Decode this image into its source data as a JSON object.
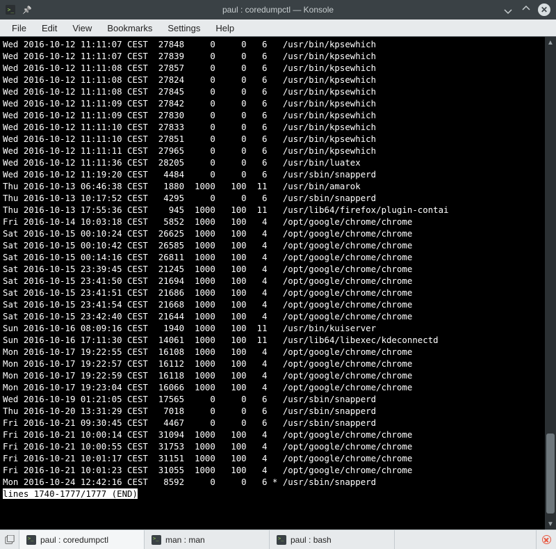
{
  "window": {
    "title": "paul : coredumpctl — Konsole"
  },
  "menubar": [
    "File",
    "Edit",
    "View",
    "Bookmarks",
    "Settings",
    "Help"
  ],
  "terminal": {
    "status_line": "lines 1740-1777/1777 (END)",
    "rows": [
      {
        "t": "Wed 2016-10-12 11:11:07 CEST",
        "pid": "27848",
        "uid": "0",
        "gid": "0",
        "sig": "6",
        "mk": " ",
        "exe": "/usr/bin/kpsewhich"
      },
      {
        "t": "Wed 2016-10-12 11:11:07 CEST",
        "pid": "27839",
        "uid": "0",
        "gid": "0",
        "sig": "6",
        "mk": " ",
        "exe": "/usr/bin/kpsewhich"
      },
      {
        "t": "Wed 2016-10-12 11:11:08 CEST",
        "pid": "27857",
        "uid": "0",
        "gid": "0",
        "sig": "6",
        "mk": " ",
        "exe": "/usr/bin/kpsewhich"
      },
      {
        "t": "Wed 2016-10-12 11:11:08 CEST",
        "pid": "27824",
        "uid": "0",
        "gid": "0",
        "sig": "6",
        "mk": " ",
        "exe": "/usr/bin/kpsewhich"
      },
      {
        "t": "Wed 2016-10-12 11:11:08 CEST",
        "pid": "27845",
        "uid": "0",
        "gid": "0",
        "sig": "6",
        "mk": " ",
        "exe": "/usr/bin/kpsewhich"
      },
      {
        "t": "Wed 2016-10-12 11:11:09 CEST",
        "pid": "27842",
        "uid": "0",
        "gid": "0",
        "sig": "6",
        "mk": " ",
        "exe": "/usr/bin/kpsewhich"
      },
      {
        "t": "Wed 2016-10-12 11:11:09 CEST",
        "pid": "27830",
        "uid": "0",
        "gid": "0",
        "sig": "6",
        "mk": " ",
        "exe": "/usr/bin/kpsewhich"
      },
      {
        "t": "Wed 2016-10-12 11:11:10 CEST",
        "pid": "27833",
        "uid": "0",
        "gid": "0",
        "sig": "6",
        "mk": " ",
        "exe": "/usr/bin/kpsewhich"
      },
      {
        "t": "Wed 2016-10-12 11:11:10 CEST",
        "pid": "27851",
        "uid": "0",
        "gid": "0",
        "sig": "6",
        "mk": " ",
        "exe": "/usr/bin/kpsewhich"
      },
      {
        "t": "Wed 2016-10-12 11:11:11 CEST",
        "pid": "27965",
        "uid": "0",
        "gid": "0",
        "sig": "6",
        "mk": " ",
        "exe": "/usr/bin/kpsewhich"
      },
      {
        "t": "Wed 2016-10-12 11:11:36 CEST",
        "pid": "28205",
        "uid": "0",
        "gid": "0",
        "sig": "6",
        "mk": " ",
        "exe": "/usr/bin/luatex"
      },
      {
        "t": "Wed 2016-10-12 11:19:20 CEST",
        "pid": "4484",
        "uid": "0",
        "gid": "0",
        "sig": "6",
        "mk": " ",
        "exe": "/usr/sbin/snapperd"
      },
      {
        "t": "Thu 2016-10-13 06:46:38 CEST",
        "pid": "1880",
        "uid": "1000",
        "gid": "100",
        "sig": "11",
        "mk": " ",
        "exe": "/usr/bin/amarok"
      },
      {
        "t": "Thu 2016-10-13 10:17:52 CEST",
        "pid": "4295",
        "uid": "0",
        "gid": "0",
        "sig": "6",
        "mk": " ",
        "exe": "/usr/sbin/snapperd"
      },
      {
        "t": "Thu 2016-10-13 17:55:36 CEST",
        "pid": "945",
        "uid": "1000",
        "gid": "100",
        "sig": "11",
        "mk": " ",
        "exe": "/usr/lib64/firefox/plugin-contai"
      },
      {
        "t": "Fri 2016-10-14 10:03:18 CEST",
        "pid": "5852",
        "uid": "1000",
        "gid": "100",
        "sig": "4",
        "mk": " ",
        "exe": "/opt/google/chrome/chrome"
      },
      {
        "t": "Sat 2016-10-15 00:10:24 CEST",
        "pid": "26625",
        "uid": "1000",
        "gid": "100",
        "sig": "4",
        "mk": " ",
        "exe": "/opt/google/chrome/chrome"
      },
      {
        "t": "Sat 2016-10-15 00:10:42 CEST",
        "pid": "26585",
        "uid": "1000",
        "gid": "100",
        "sig": "4",
        "mk": " ",
        "exe": "/opt/google/chrome/chrome"
      },
      {
        "t": "Sat 2016-10-15 00:14:16 CEST",
        "pid": "26811",
        "uid": "1000",
        "gid": "100",
        "sig": "4",
        "mk": " ",
        "exe": "/opt/google/chrome/chrome"
      },
      {
        "t": "Sat 2016-10-15 23:39:45 CEST",
        "pid": "21245",
        "uid": "1000",
        "gid": "100",
        "sig": "4",
        "mk": " ",
        "exe": "/opt/google/chrome/chrome"
      },
      {
        "t": "Sat 2016-10-15 23:41:50 CEST",
        "pid": "21694",
        "uid": "1000",
        "gid": "100",
        "sig": "4",
        "mk": " ",
        "exe": "/opt/google/chrome/chrome"
      },
      {
        "t": "Sat 2016-10-15 23:41:51 CEST",
        "pid": "21686",
        "uid": "1000",
        "gid": "100",
        "sig": "4",
        "mk": " ",
        "exe": "/opt/google/chrome/chrome"
      },
      {
        "t": "Sat 2016-10-15 23:41:54 CEST",
        "pid": "21668",
        "uid": "1000",
        "gid": "100",
        "sig": "4",
        "mk": " ",
        "exe": "/opt/google/chrome/chrome"
      },
      {
        "t": "Sat 2016-10-15 23:42:40 CEST",
        "pid": "21644",
        "uid": "1000",
        "gid": "100",
        "sig": "4",
        "mk": " ",
        "exe": "/opt/google/chrome/chrome"
      },
      {
        "t": "Sun 2016-10-16 08:09:16 CEST",
        "pid": "1940",
        "uid": "1000",
        "gid": "100",
        "sig": "11",
        "mk": " ",
        "exe": "/usr/bin/kuiserver"
      },
      {
        "t": "Sun 2016-10-16 17:11:30 CEST",
        "pid": "14061",
        "uid": "1000",
        "gid": "100",
        "sig": "11",
        "mk": " ",
        "exe": "/usr/lib64/libexec/kdeconnectd"
      },
      {
        "t": "Mon 2016-10-17 19:22:55 CEST",
        "pid": "16108",
        "uid": "1000",
        "gid": "100",
        "sig": "4",
        "mk": " ",
        "exe": "/opt/google/chrome/chrome"
      },
      {
        "t": "Mon 2016-10-17 19:22:57 CEST",
        "pid": "16112",
        "uid": "1000",
        "gid": "100",
        "sig": "4",
        "mk": " ",
        "exe": "/opt/google/chrome/chrome"
      },
      {
        "t": "Mon 2016-10-17 19:22:59 CEST",
        "pid": "16118",
        "uid": "1000",
        "gid": "100",
        "sig": "4",
        "mk": " ",
        "exe": "/opt/google/chrome/chrome"
      },
      {
        "t": "Mon 2016-10-17 19:23:04 CEST",
        "pid": "16066",
        "uid": "1000",
        "gid": "100",
        "sig": "4",
        "mk": " ",
        "exe": "/opt/google/chrome/chrome"
      },
      {
        "t": "Wed 2016-10-19 01:21:05 CEST",
        "pid": "17565",
        "uid": "0",
        "gid": "0",
        "sig": "6",
        "mk": " ",
        "exe": "/usr/sbin/snapperd"
      },
      {
        "t": "Thu 2016-10-20 13:31:29 CEST",
        "pid": "7018",
        "uid": "0",
        "gid": "0",
        "sig": "6",
        "mk": " ",
        "exe": "/usr/sbin/snapperd"
      },
      {
        "t": "Fri 2016-10-21 09:30:45 CEST",
        "pid": "4467",
        "uid": "0",
        "gid": "0",
        "sig": "6",
        "mk": " ",
        "exe": "/usr/sbin/snapperd"
      },
      {
        "t": "Fri 2016-10-21 10:00:14 CEST",
        "pid": "31094",
        "uid": "1000",
        "gid": "100",
        "sig": "4",
        "mk": " ",
        "exe": "/opt/google/chrome/chrome"
      },
      {
        "t": "Fri 2016-10-21 10:00:55 CEST",
        "pid": "31753",
        "uid": "1000",
        "gid": "100",
        "sig": "4",
        "mk": " ",
        "exe": "/opt/google/chrome/chrome"
      },
      {
        "t": "Fri 2016-10-21 10:01:17 CEST",
        "pid": "31151",
        "uid": "1000",
        "gid": "100",
        "sig": "4",
        "mk": " ",
        "exe": "/opt/google/chrome/chrome"
      },
      {
        "t": "Fri 2016-10-21 10:01:23 CEST",
        "pid": "31055",
        "uid": "1000",
        "gid": "100",
        "sig": "4",
        "mk": " ",
        "exe": "/opt/google/chrome/chrome"
      },
      {
        "t": "Mon 2016-10-24 12:42:16 CEST",
        "pid": "8592",
        "uid": "0",
        "gid": "0",
        "sig": "6",
        "mk": "*",
        "exe": "/usr/sbin/snapperd"
      }
    ]
  },
  "tabs": [
    {
      "label": "paul : coredumpctl",
      "active": true
    },
    {
      "label": "man : man",
      "active": false
    },
    {
      "label": "paul : bash",
      "active": false
    }
  ]
}
